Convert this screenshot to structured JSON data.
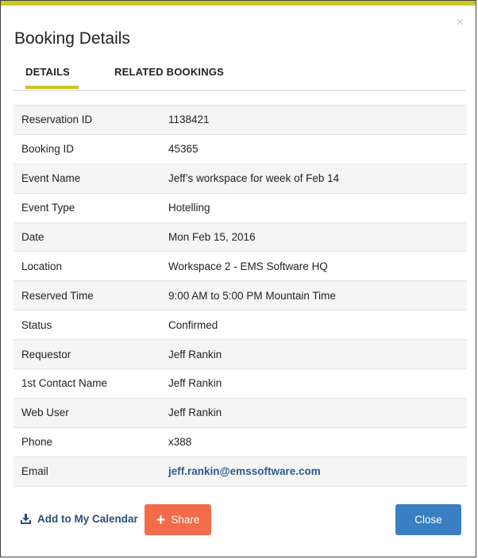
{
  "dialog": {
    "title": "Booking Details",
    "close_glyph": "×"
  },
  "tabs": [
    {
      "label": "DETAILS",
      "active": true
    },
    {
      "label": "RELATED BOOKINGS",
      "active": false
    }
  ],
  "details": [
    {
      "label": "Reservation ID",
      "value": "1138421"
    },
    {
      "label": "Booking ID",
      "value": "45365"
    },
    {
      "label": "Event Name",
      "value": "Jeff’s workspace for week of Feb 14"
    },
    {
      "label": "Event Type",
      "value": "Hotelling"
    },
    {
      "label": "Date",
      "value": "Mon Feb 15, 2016"
    },
    {
      "label": "Location",
      "value": "Workspace 2 - EMS Software HQ"
    },
    {
      "label": "Reserved Time",
      "value": "9:00 AM to 5:00 PM Mountain Time"
    },
    {
      "label": "Status",
      "value": "Confirmed"
    },
    {
      "label": "Requestor",
      "value": "Jeff Rankin"
    },
    {
      "label": "1st Contact Name",
      "value": "Jeff Rankin"
    },
    {
      "label": "Web User",
      "value": "Jeff Rankin"
    },
    {
      "label": "Phone",
      "value": "x388"
    },
    {
      "label": "Email",
      "value": "jeff.rankin@emssoftware.com"
    }
  ],
  "footer": {
    "calendar_label": "Add to My Calendar",
    "calendar_icon": "download-icon",
    "share_label": "Share",
    "share_icon": "plus-icon",
    "close_label": "Close"
  },
  "colors": {
    "accent": "#cdc623",
    "share": "#f26b4a",
    "close": "#3a7fc2",
    "link": "#2b5b8c"
  }
}
